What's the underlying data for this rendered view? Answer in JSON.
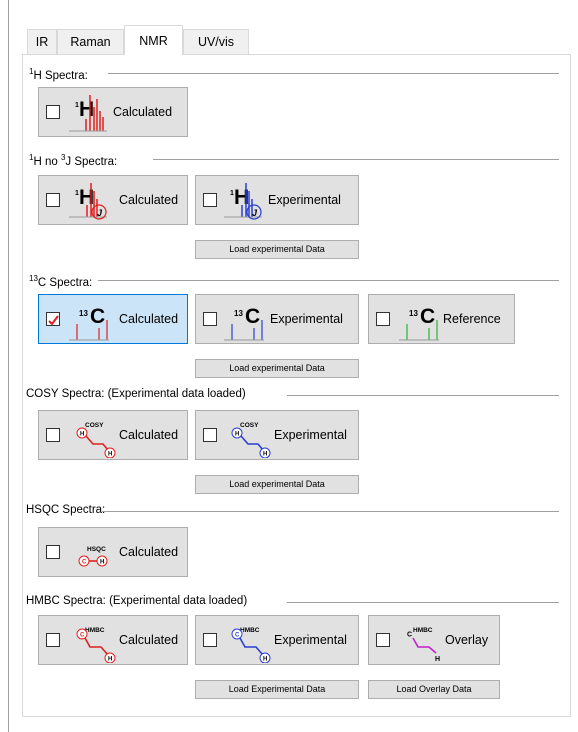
{
  "tabs": [
    "IR",
    "Raman",
    "NMR",
    "UV/vis"
  ],
  "active_tab": "NMR",
  "sections": {
    "h1": {
      "sup": "1",
      "title": "H Spectra:"
    },
    "h1noj": {
      "sup1": "1",
      "mid": "H  no ",
      "sup2": "3",
      "title": "J Spectra:"
    },
    "c13": {
      "sup": "13",
      "title": "C Spectra:"
    },
    "cosy": {
      "title": "COSY Spectra:  (Experimental data loaded)"
    },
    "hsqc": {
      "title": "HSQC Spectra:"
    },
    "hmbc": {
      "title": "HMBC Spectra:  (Experimental data loaded)"
    }
  },
  "buttons": {
    "calculated": "Calculated",
    "experimental": "Experimental",
    "reference": "Reference",
    "overlay": "Overlay"
  },
  "small_buttons": {
    "load_exp": "Load experimental Data",
    "load_exp_cap": "Load Experimental Data",
    "load_overlay": "Load Overlay Data"
  },
  "icon_text": {
    "h": "H",
    "h_sup": "1",
    "c": "C",
    "c_sup": "13",
    "cosy": "COSY",
    "hsqc": "HSQC",
    "hmbc": "HMBC",
    "atom_h": "H",
    "atom_c": "C",
    "j": "J"
  },
  "colors": {
    "red": "#e02020",
    "blue": "#2a3fd0",
    "green": "#22b830",
    "purple": "#c21fd0",
    "checked_bg": "#cce4f7"
  }
}
